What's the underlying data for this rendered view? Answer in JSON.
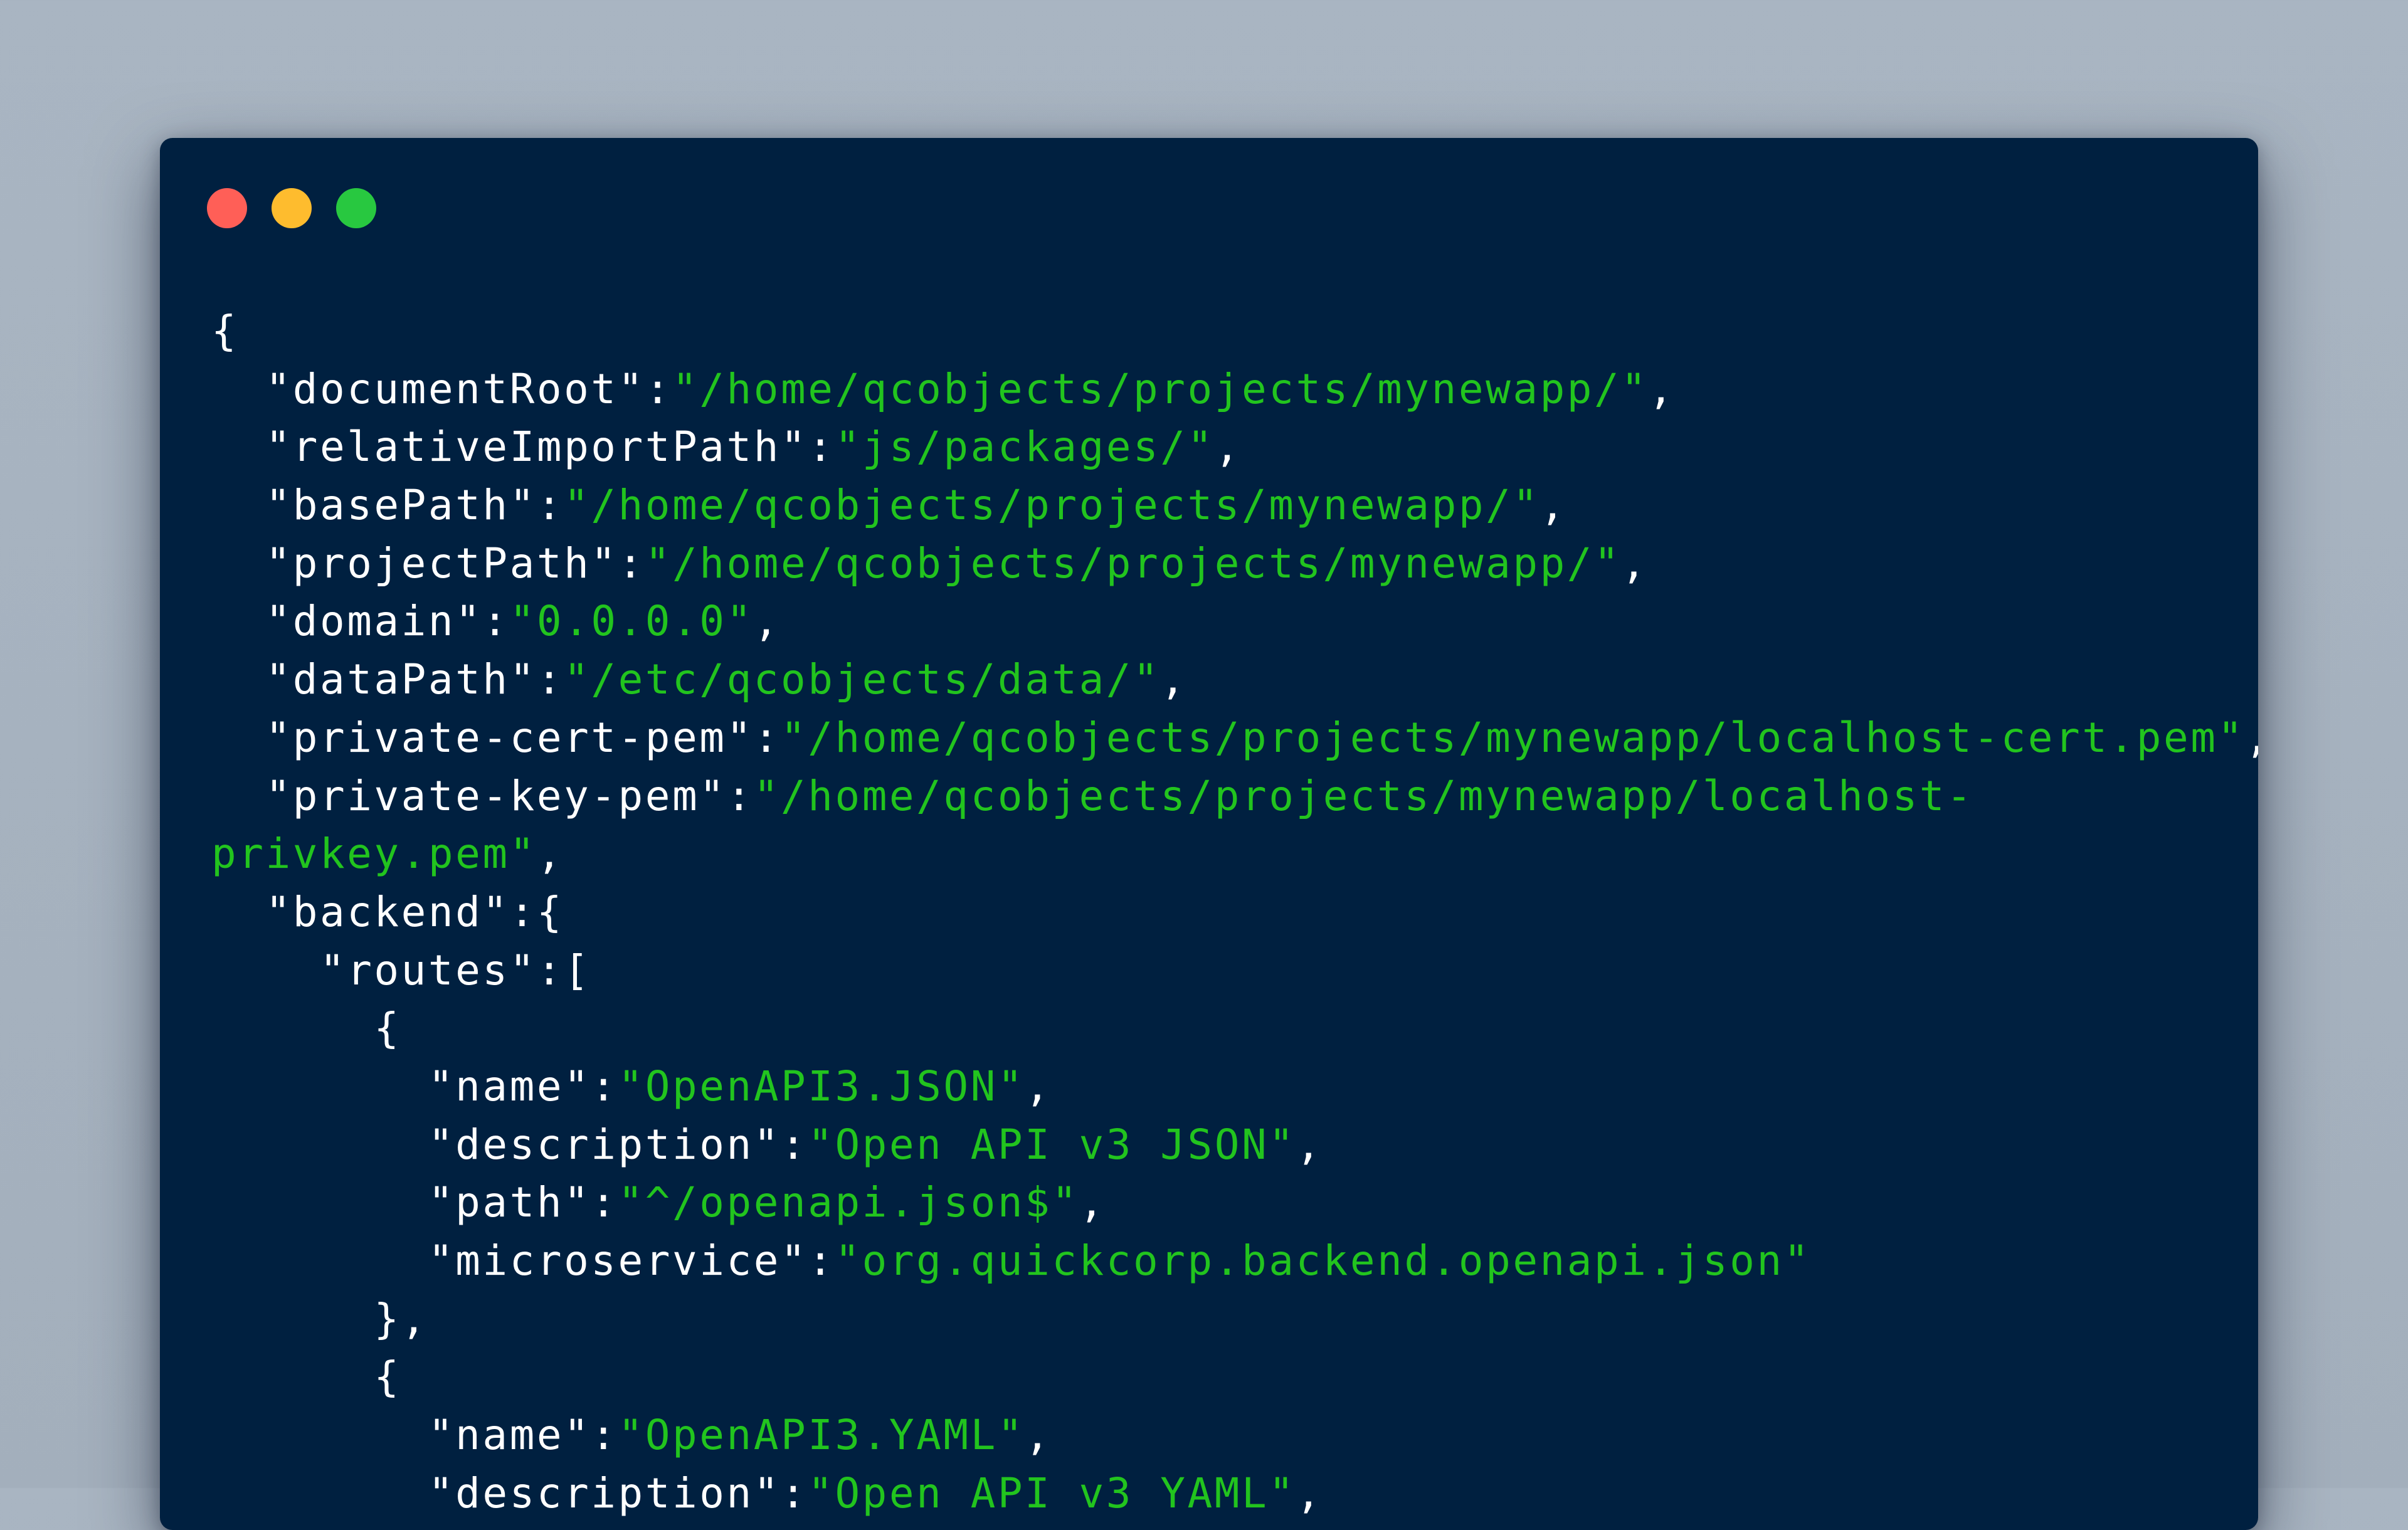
{
  "window": {
    "controls": [
      {
        "name": "close-button",
        "color": "#ff5f57"
      },
      {
        "name": "minimize-button",
        "color": "#febc2e"
      },
      {
        "name": "maximize-button",
        "color": "#28c840"
      }
    ]
  },
  "code": {
    "colors": {
      "key": "#ffffff",
      "string": "#22c41e",
      "background": "#002040"
    },
    "lines": [
      {
        "indent": "",
        "parts": [
          {
            "t": "p",
            "v": "{"
          }
        ]
      },
      {
        "indent": "  ",
        "parts": [
          {
            "t": "k",
            "v": "\"documentRoot\""
          },
          {
            "t": "p",
            "v": ":"
          },
          {
            "t": "s",
            "v": "\"/home/qcobjects/projects/mynewapp/\""
          },
          {
            "t": "p",
            "v": ","
          }
        ]
      },
      {
        "indent": "  ",
        "parts": [
          {
            "t": "k",
            "v": "\"relativeImportPath\""
          },
          {
            "t": "p",
            "v": ":"
          },
          {
            "t": "s",
            "v": "\"js/packages/\""
          },
          {
            "t": "p",
            "v": ","
          }
        ]
      },
      {
        "indent": "  ",
        "parts": [
          {
            "t": "k",
            "v": "\"basePath\""
          },
          {
            "t": "p",
            "v": ":"
          },
          {
            "t": "s",
            "v": "\"/home/qcobjects/projects/mynewapp/\""
          },
          {
            "t": "p",
            "v": ","
          }
        ]
      },
      {
        "indent": "  ",
        "parts": [
          {
            "t": "k",
            "v": "\"projectPath\""
          },
          {
            "t": "p",
            "v": ":"
          },
          {
            "t": "s",
            "v": "\"/home/qcobjects/projects/mynewapp/\""
          },
          {
            "t": "p",
            "v": ","
          }
        ]
      },
      {
        "indent": "  ",
        "parts": [
          {
            "t": "k",
            "v": "\"domain\""
          },
          {
            "t": "p",
            "v": ":"
          },
          {
            "t": "s",
            "v": "\"0.0.0.0\""
          },
          {
            "t": "p",
            "v": ","
          }
        ]
      },
      {
        "indent": "  ",
        "parts": [
          {
            "t": "k",
            "v": "\"dataPath\""
          },
          {
            "t": "p",
            "v": ":"
          },
          {
            "t": "s",
            "v": "\"/etc/qcobjects/data/\""
          },
          {
            "t": "p",
            "v": ","
          }
        ]
      },
      {
        "indent": "  ",
        "parts": [
          {
            "t": "k",
            "v": "\"private-cert-pem\""
          },
          {
            "t": "p",
            "v": ":"
          },
          {
            "t": "s",
            "v": "\"/home/qcobjects/projects/mynewapp/localhost-cert.pem\""
          },
          {
            "t": "p",
            "v": ","
          }
        ]
      },
      {
        "indent": "  ",
        "parts": [
          {
            "t": "k",
            "v": "\"private-key-pem\""
          },
          {
            "t": "p",
            "v": ":"
          },
          {
            "t": "s",
            "v": "\"/home/qcobjects/projects/mynewapp/localhost-"
          }
        ]
      },
      {
        "indent": "",
        "parts": [
          {
            "t": "s",
            "v": "privkey.pem\""
          },
          {
            "t": "p",
            "v": ","
          }
        ]
      },
      {
        "indent": "  ",
        "parts": [
          {
            "t": "k",
            "v": "\"backend\""
          },
          {
            "t": "p",
            "v": ":{"
          }
        ]
      },
      {
        "indent": "    ",
        "parts": [
          {
            "t": "k",
            "v": "\"routes\""
          },
          {
            "t": "p",
            "v": ":["
          }
        ]
      },
      {
        "indent": "      ",
        "parts": [
          {
            "t": "p",
            "v": "{"
          }
        ]
      },
      {
        "indent": "        ",
        "parts": [
          {
            "t": "k",
            "v": "\"name\""
          },
          {
            "t": "p",
            "v": ":"
          },
          {
            "t": "s",
            "v": "\"OpenAPI3.JSON\""
          },
          {
            "t": "p",
            "v": ","
          }
        ]
      },
      {
        "indent": "        ",
        "parts": [
          {
            "t": "k",
            "v": "\"description\""
          },
          {
            "t": "p",
            "v": ":"
          },
          {
            "t": "s",
            "v": "\"Open API v3 JSON\""
          },
          {
            "t": "p",
            "v": ","
          }
        ]
      },
      {
        "indent": "        ",
        "parts": [
          {
            "t": "k",
            "v": "\"path\""
          },
          {
            "t": "p",
            "v": ":"
          },
          {
            "t": "s",
            "v": "\"^/openapi.json$\""
          },
          {
            "t": "p",
            "v": ","
          }
        ]
      },
      {
        "indent": "        ",
        "parts": [
          {
            "t": "k",
            "v": "\"microservice\""
          },
          {
            "t": "p",
            "v": ":"
          },
          {
            "t": "s",
            "v": "\"org.quickcorp.backend.openapi.json\""
          }
        ]
      },
      {
        "indent": "      ",
        "parts": [
          {
            "t": "p",
            "v": "},"
          }
        ]
      },
      {
        "indent": "      ",
        "parts": [
          {
            "t": "p",
            "v": "{"
          }
        ]
      },
      {
        "indent": "        ",
        "parts": [
          {
            "t": "k",
            "v": "\"name\""
          },
          {
            "t": "p",
            "v": ":"
          },
          {
            "t": "s",
            "v": "\"OpenAPI3.YAML\""
          },
          {
            "t": "p",
            "v": ","
          }
        ]
      },
      {
        "indent": "        ",
        "parts": [
          {
            "t": "k",
            "v": "\"description\""
          },
          {
            "t": "p",
            "v": ":"
          },
          {
            "t": "s",
            "v": "\"Open API v3 YAML\""
          },
          {
            "t": "p",
            "v": ","
          }
        ]
      }
    ]
  }
}
